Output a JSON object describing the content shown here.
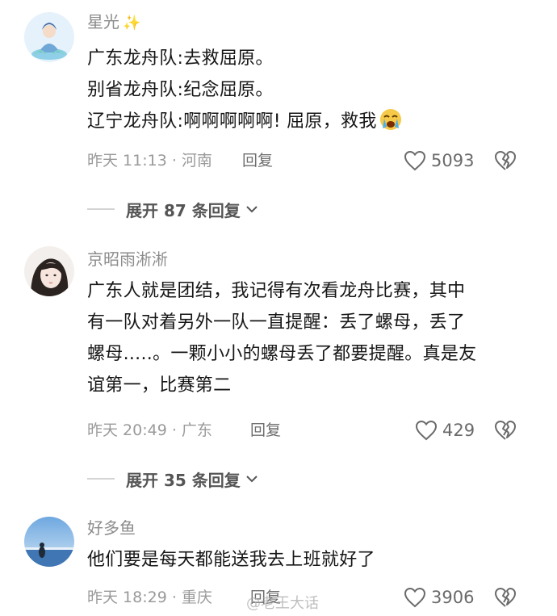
{
  "comments": [
    {
      "username": "星光",
      "username_sparkle": "✨",
      "lines": [
        "广东龙舟队:去救屈原。",
        "别省龙舟队:纪念屈原。",
        "辽宁龙舟队:啊啊啊啊啊! 屈原，救我"
      ],
      "time_location": "昨天 11:13 · 河南",
      "reply_label": "回复",
      "like_count": "5093",
      "expand_label": "展开 87 条回复"
    },
    {
      "username": "京昭雨淅淅",
      "lines": [
        "广东人就是团结，我记得有次看龙舟比赛，其中",
        "有一队对着另外一队一直提醒：丢了螺母，丢了",
        "螺母.....。一颗小小的螺母丢了都要提醒。真是友",
        "谊第一，比赛第二"
      ],
      "time_location": "昨天 20:49 · 广东",
      "reply_label": "回复",
      "like_count": "429",
      "expand_label": "展开 35 条回复"
    },
    {
      "username": "好多鱼",
      "lines": [
        "他们要是每天都能送我去上班就好了"
      ],
      "time_location": "昨天 18:29 · 重庆",
      "reply_label": "回复",
      "like_count": "3906"
    }
  ],
  "watermark": "@老王大话",
  "colors": {
    "username": "#8c8c8c",
    "body": "#161616",
    "meta": "#9a9a9a",
    "icon": "#6a6a6a"
  },
  "icons": {
    "like": "heart-outline-icon",
    "dislike": "broken-heart-icon",
    "expand": "chevron-down-icon",
    "emoji": "crying-face-emoji"
  }
}
